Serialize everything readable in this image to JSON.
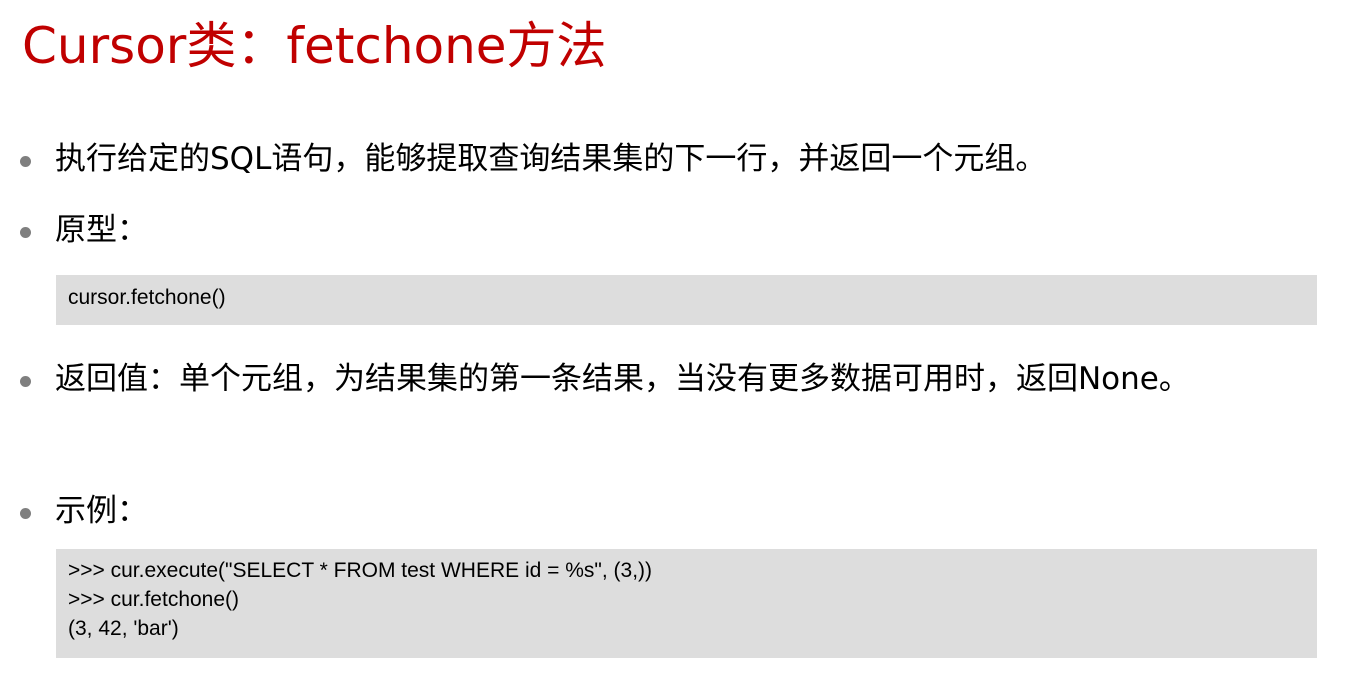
{
  "colors": {
    "title": "#c00000",
    "bullet": "#7f7f7f",
    "code_background": "#dddddd",
    "text": "#000000"
  },
  "title": "Cursor类：fetchone方法",
  "bullets": [
    {
      "text": "执行给定的SQL语句，能够提取查询结果集的下一行，并返回一个元组。"
    },
    {
      "text": "原型："
    },
    {
      "text": "返回值：单个元组，为结果集的第一条结果，当没有更多数据可用时，返回None。"
    },
    {
      "text": "示例："
    }
  ],
  "prototype_code": [
    "cursor.fetchone()"
  ],
  "example_code": [
    ">>> cur.execute(\"SELECT * FROM test WHERE id = %s\", (3,))",
    ">>> cur.fetchone()",
    "(3, 42, 'bar')"
  ]
}
